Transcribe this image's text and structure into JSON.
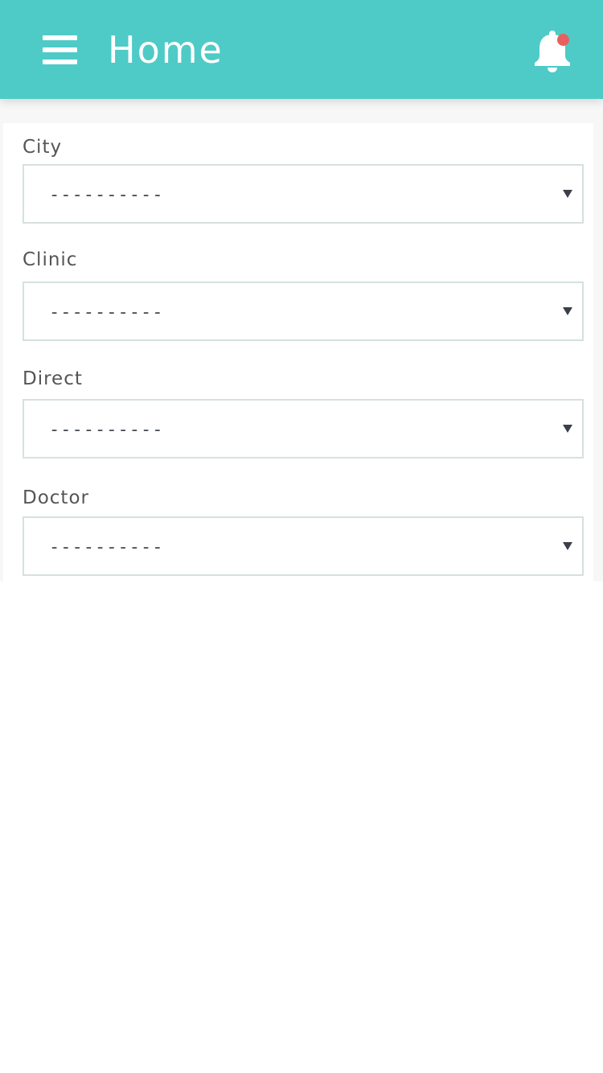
{
  "colors": {
    "brand": "#4ecbc7",
    "notification_dot": "#e8605e"
  },
  "header": {
    "title": "Home",
    "menu_icon": "hamburger-menu-icon",
    "notification_icon": "bell-icon",
    "has_unread_notification": true
  },
  "form": {
    "fields": [
      {
        "label": "City",
        "value": "----------"
      },
      {
        "label": "Clinic",
        "value": "----------"
      },
      {
        "label": "Direct",
        "value": "----------"
      },
      {
        "label": "Doctor",
        "value": "----------"
      }
    ]
  }
}
